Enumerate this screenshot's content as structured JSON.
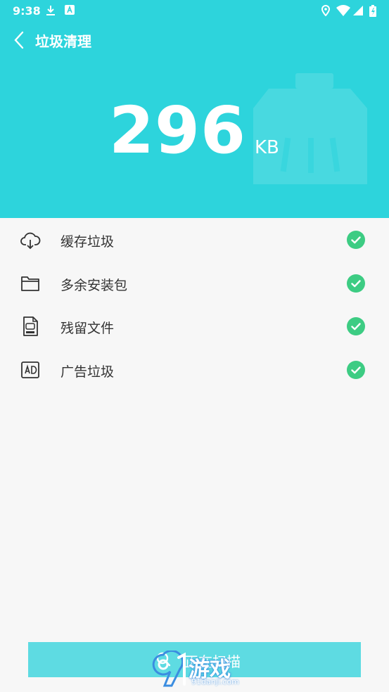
{
  "status_bar": {
    "time": "9:38"
  },
  "header": {
    "title": "垃圾清理"
  },
  "summary": {
    "size_value": "296",
    "size_unit": "KB"
  },
  "categories": [
    {
      "label": "缓存垃圾",
      "icon": "cloud-icon"
    },
    {
      "label": "多余安装包",
      "icon": "folder-icon"
    },
    {
      "label": "残留文件",
      "icon": "apk-file-icon"
    },
    {
      "label": "广告垃圾",
      "icon": "ad-icon"
    }
  ],
  "scan_button": {
    "label": "正在扫描"
  },
  "watermark": {
    "text": "游戏",
    "url": "91danji.com"
  },
  "colors": {
    "accent": "#2dd4dc",
    "check": "#3dcc83",
    "button": "#5edbe2"
  }
}
